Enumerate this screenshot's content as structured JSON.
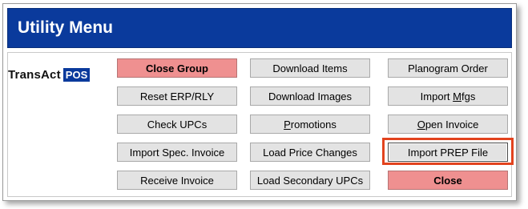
{
  "window": {
    "title": "Utility Menu"
  },
  "logo": {
    "text": "TransAct",
    "badge": "POS"
  },
  "buttons": {
    "col1": [
      {
        "label": "Close Group"
      },
      {
        "label": "Reset ERP/RLY"
      },
      {
        "label": "Check UPCs"
      },
      {
        "label": "Import Spec. Invoice"
      },
      {
        "label": "Receive Invoice"
      }
    ],
    "col2": [
      {
        "label": "Download Items"
      },
      {
        "label": "Download Images"
      },
      {
        "pre": "",
        "mnemonic": "P",
        "post": "romotions"
      },
      {
        "label": "Load Price Changes"
      },
      {
        "label": "Load Secondary UPCs"
      }
    ],
    "col3": [
      {
        "label": "Planogram Order"
      },
      {
        "pre": "Import ",
        "mnemonic": "M",
        "post": "fgs"
      },
      {
        "pre": "",
        "mnemonic": "O",
        "post": "pen Invoice"
      },
      {
        "label": "Import PREP File"
      },
      {
        "label": "Close"
      }
    ]
  },
  "colors": {
    "titlebar": "#0a3a9c",
    "button": "#e3e3e3",
    "button_red": "#ef9090",
    "highlight": "#e2431e"
  }
}
